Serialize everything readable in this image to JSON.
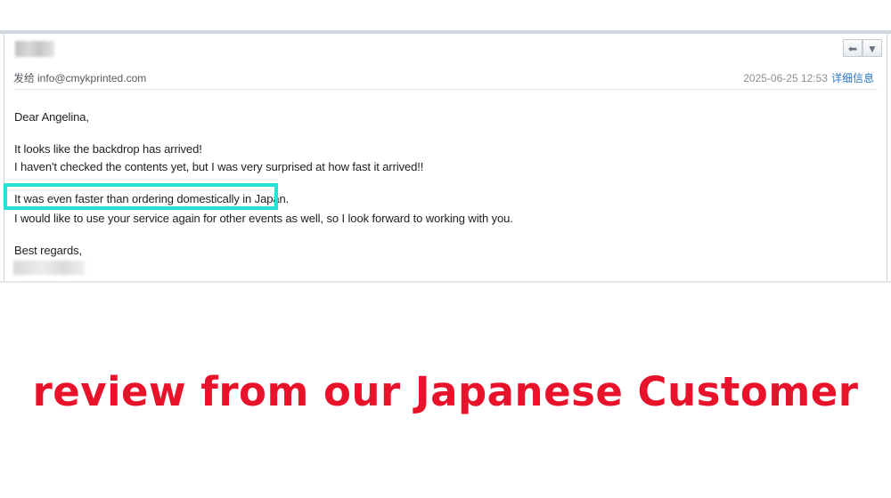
{
  "email": {
    "to_prefix": "发给",
    "to_address": "info@cmykprinted.com",
    "date": "2025-06-25 12:53",
    "details_link": "详细信息",
    "reply_icon": "reply-arrow-icon",
    "more_icon": "dropdown-triangle-icon",
    "greeting": "Dear Angelina,",
    "lines": [
      "It looks like the backdrop has arrived!",
      "I haven't checked the contents yet, but I was very surprised at how fast it arrived!!",
      "It was even faster than ordering domestically in Japan.",
      "I would like to use your service again for other events as well, so I look forward to working with you."
    ],
    "closing": "Best regards,"
  },
  "caption": "review from our Japanese Customer",
  "colors": {
    "highlight": "#29e0d6",
    "caption": "#e8132b",
    "link": "#2a78c6"
  }
}
